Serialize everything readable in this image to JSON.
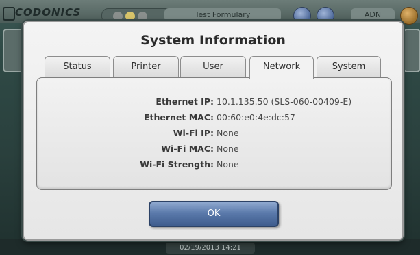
{
  "background_app": {
    "logo_text": "CODONICS",
    "formulary_label": "Test Formulary",
    "user_label": "ADN",
    "datetime": "02/19/2013 14:21"
  },
  "dialog": {
    "title": "System Information",
    "tabs": [
      {
        "label": "Status",
        "active": false
      },
      {
        "label": "Printer",
        "active": false
      },
      {
        "label": "User",
        "active": false
      },
      {
        "label": "Network",
        "active": true
      },
      {
        "label": "System",
        "active": false
      }
    ],
    "network": {
      "rows": [
        {
          "label": "Ethernet IP:",
          "value": "10.1.135.50 (SLS-060-00409-E)"
        },
        {
          "label": "Ethernet MAC:",
          "value": "00:60:e0:4e:dc:57"
        },
        {
          "label": "Wi-Fi IP:",
          "value": "None"
        },
        {
          "label": "Wi-Fi MAC:",
          "value": "None"
        },
        {
          "label": "Wi-Fi Strength:",
          "value": "None"
        }
      ]
    },
    "ok_label": "OK"
  },
  "colors": {
    "accent": "#5b7aab",
    "background": "#2f4a46"
  },
  "icons": {
    "status_dots": "status-indicator-icon",
    "help": "help-icon",
    "gear": "gear-icon"
  }
}
